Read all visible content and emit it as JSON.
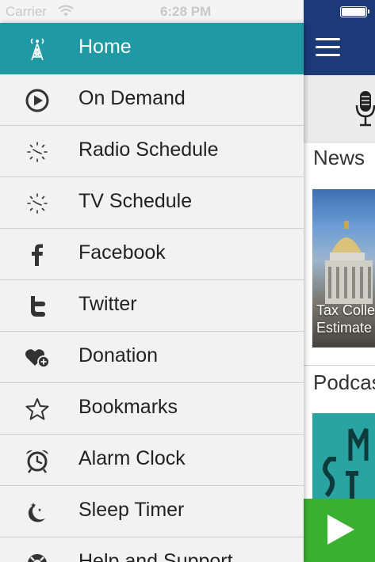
{
  "status_bar": {
    "carrier": "Carrier",
    "time": "6:28 PM"
  },
  "menu": {
    "items": [
      {
        "label": "Home",
        "icon": "radio-tower-icon",
        "active": true
      },
      {
        "label": "On Demand",
        "icon": "play-circle-icon"
      },
      {
        "label": "Radio Schedule",
        "icon": "clock-icon"
      },
      {
        "label": "TV Schedule",
        "icon": "clock-icon"
      },
      {
        "label": "Facebook",
        "icon": "facebook-icon"
      },
      {
        "label": "Twitter",
        "icon": "twitter-icon"
      },
      {
        "label": "Donation",
        "icon": "heart-plus-icon"
      },
      {
        "label": "Bookmarks",
        "icon": "star-icon"
      },
      {
        "label": "Alarm Clock",
        "icon": "alarm-clock-icon"
      },
      {
        "label": "Sleep Timer",
        "icon": "moon-stars-icon"
      },
      {
        "label": "Help and Support",
        "icon": "lifebuoy-icon"
      }
    ]
  },
  "background_app": {
    "sections": {
      "news": "News",
      "podcasts": "Podcas"
    },
    "news_card_caption": [
      "Tax Colle",
      "Estimate"
    ]
  },
  "colors": {
    "drawer_active": "#1f9aa4",
    "navbar": "#1c3a78",
    "play_button": "#3ab030"
  }
}
